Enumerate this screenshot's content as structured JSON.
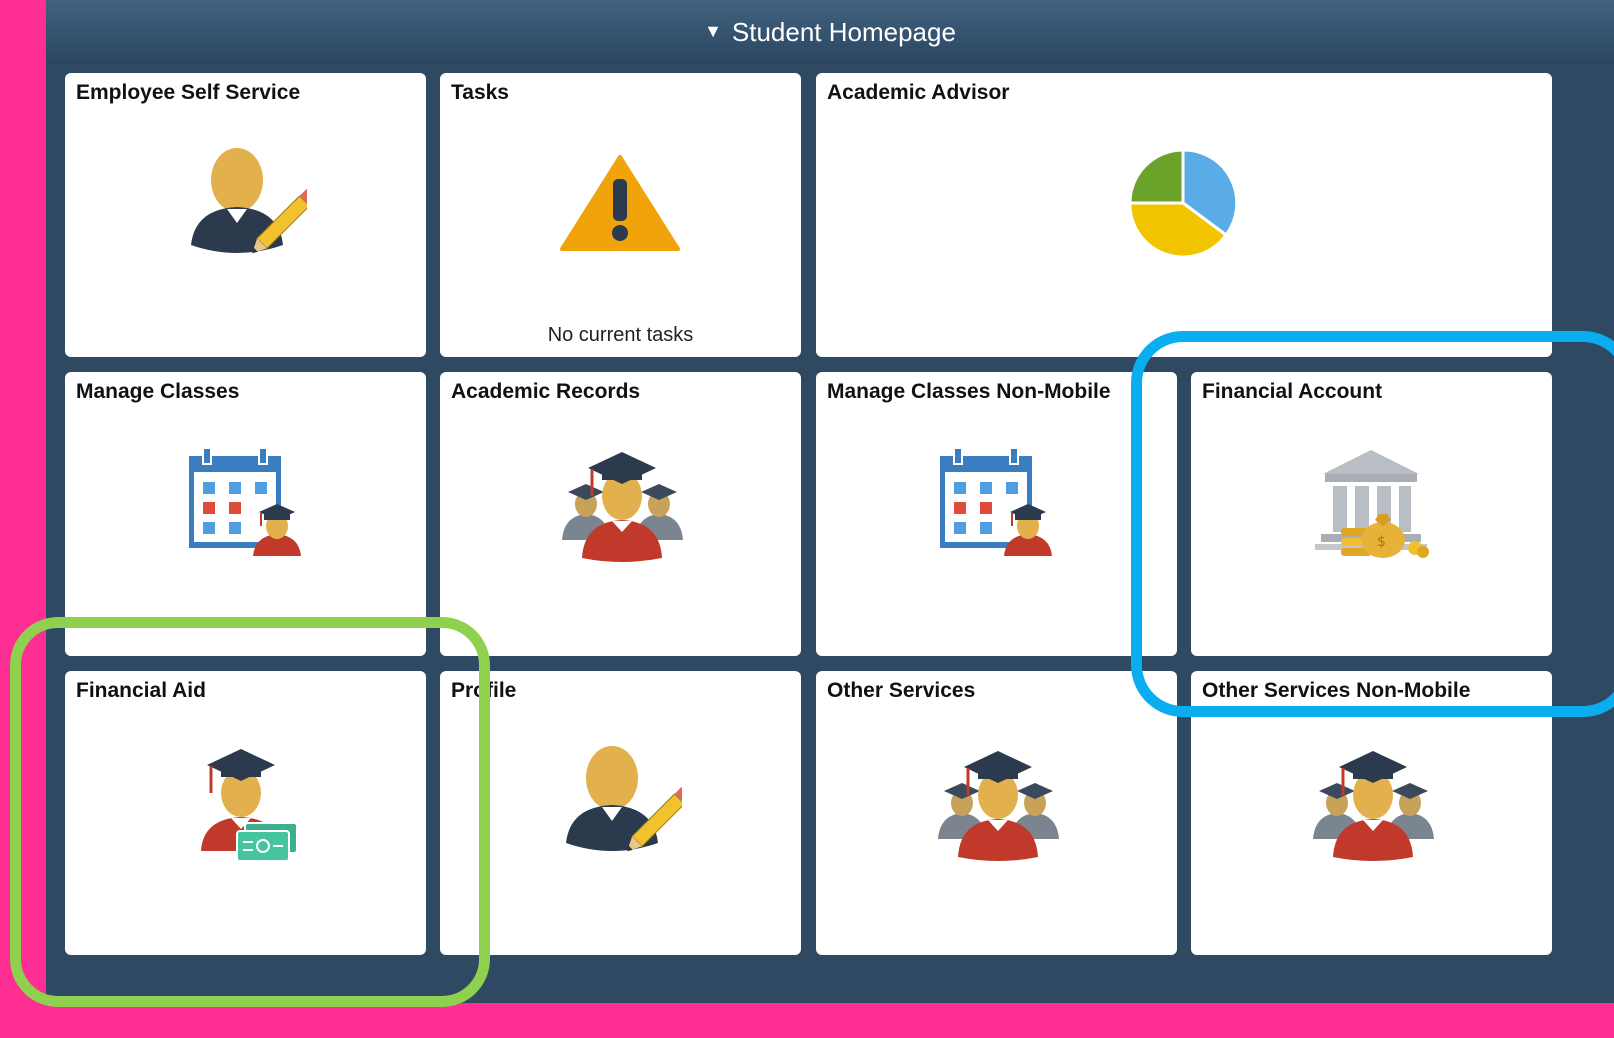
{
  "header": {
    "caret": "▼",
    "title": "Student Homepage"
  },
  "tiles": [
    {
      "title": "Employee Self Service",
      "icon": "person-pencil-icon"
    },
    {
      "title": "Tasks",
      "icon": "warning-icon",
      "status": "No current tasks"
    },
    {
      "title": "Academic Advisor",
      "icon": "pie-chart-icon"
    },
    {
      "title": "Manage Classes",
      "icon": "calendar-student-icon"
    },
    {
      "title": "Academic Records",
      "icon": "graduates-icon"
    },
    {
      "title": "Manage Classes Non-Mobile",
      "icon": "calendar-student-icon"
    },
    {
      "title": "Financial Account",
      "icon": "bank-moneybag-icon"
    },
    {
      "title": "Financial Aid",
      "icon": "graduate-cash-icon"
    },
    {
      "title": "Profile",
      "icon": "person-pencil-icon"
    },
    {
      "title": "Other Services",
      "icon": "graduates-icon"
    },
    {
      "title": "Other Services Non-Mobile",
      "icon": "graduates-icon"
    }
  ],
  "annotations": [
    {
      "label": "financial-account-highlight",
      "color": "#0aaef0"
    },
    {
      "label": "financial-aid-highlight",
      "color": "#8fd14f"
    }
  ]
}
